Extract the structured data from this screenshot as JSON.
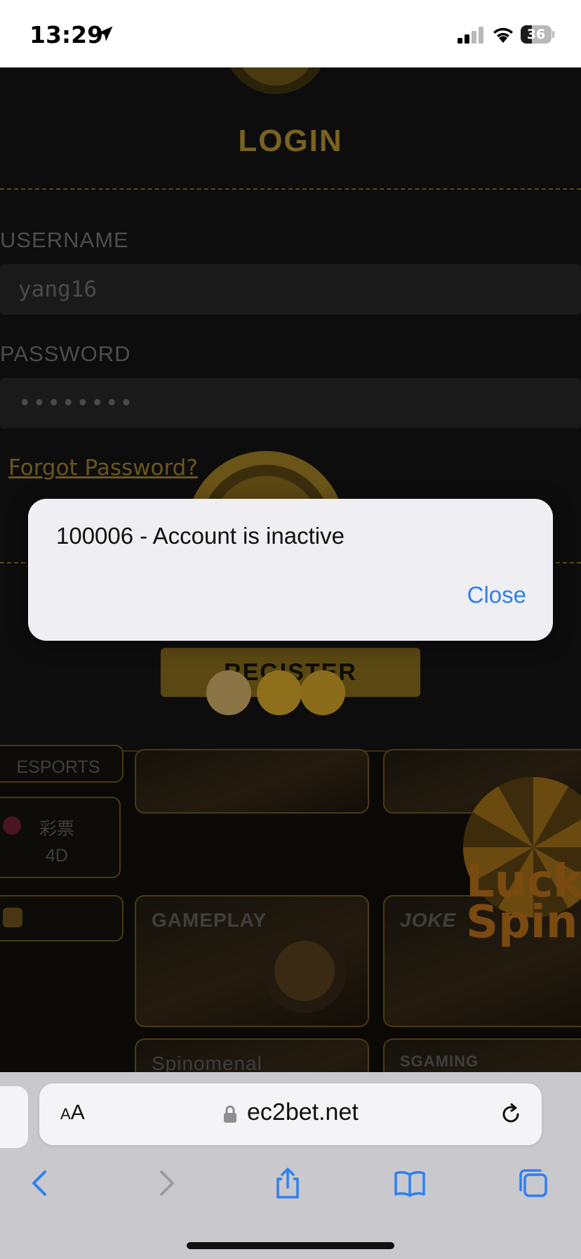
{
  "status_bar": {
    "time": "13:29",
    "battery_level": "36",
    "icons": [
      "location-arrow-icon",
      "cellular-signal-icon",
      "wifi-icon",
      "battery-icon"
    ]
  },
  "page": {
    "title": "LOGIN",
    "username_label": "USERNAME",
    "username_value": "yang16",
    "password_label": "PASSWORD",
    "password_value": "••••••••",
    "forgot_password": "Forgot Password?",
    "register_button": "REGISTER",
    "categories": [
      {
        "label": "ESPORTS"
      },
      {
        "label": "彩票",
        "sublabel": "4D"
      }
    ],
    "games": [
      {
        "name": "GAMEPLAY"
      },
      {
        "name": "JOKE"
      },
      {
        "name": "Spinomenal"
      },
      {
        "name": "SGAMING"
      }
    ],
    "promo_text": "Lucky Spin"
  },
  "alert": {
    "message": "100006 - Account is inactive",
    "close_label": "Close"
  },
  "safari": {
    "aa_label_small": "A",
    "aa_label_large": "A",
    "url": "ec2bet.net",
    "toolbar_icons": [
      "back-icon",
      "forward-icon",
      "share-icon",
      "bookmarks-icon",
      "tabs-icon"
    ]
  },
  "colors": {
    "alert_background": "#efeef3",
    "alert_button": "#2f7ff0",
    "brand_gold": "#c8a033",
    "status_bar": "#ffffff",
    "safari_background": "#c9c8cd"
  }
}
